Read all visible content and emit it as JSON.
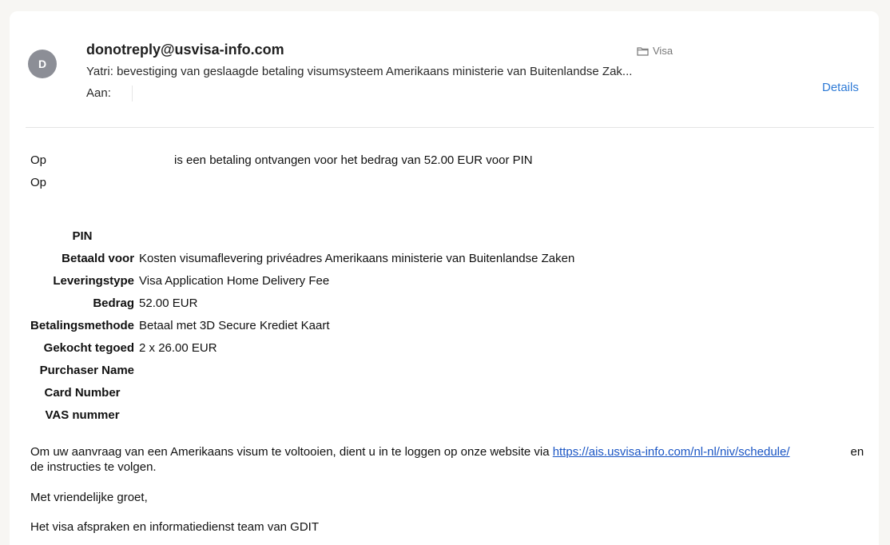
{
  "email": {
    "avatar_initial": "D",
    "sender": "donotreply@usvisa-info.com",
    "folder": "Visa",
    "subject": "Yatri: bevestiging van geslaagde betaling visumsysteem Amerikaans ministerie van Buitenlandse Zak...",
    "to_label": "Aan:",
    "details_label": "Details"
  },
  "body": {
    "intro_prefix": "Op",
    "intro_rest": "is een betaling ontvangen voor het bedrag van 52.00 EUR voor PIN",
    "intro_line2": "Op",
    "table": [
      {
        "label": "PIN",
        "value": ""
      },
      {
        "label": "Betaald voor",
        "value": "Kosten visumaflevering privéadres Amerikaans ministerie van Buitenlandse Zaken"
      },
      {
        "label": "Leveringstype",
        "value": "Visa Application Home Delivery Fee"
      },
      {
        "label": "Bedrag",
        "value": "52.00 EUR"
      },
      {
        "label": "Betalingsmethode",
        "value": "Betaal met 3D Secure Krediet Kaart"
      },
      {
        "label": "Gekocht tegoed",
        "value": "2 x 26.00 EUR"
      },
      {
        "label": "Purchaser Name",
        "value": ""
      },
      {
        "label": "Card Number",
        "value": ""
      },
      {
        "label": "VAS nummer",
        "value": ""
      }
    ],
    "instruction_before": "Om uw aanvraag van een Amerikaans visum te voltooien, dient u in te loggen op onze website via ",
    "instruction_link": "https://ais.usvisa-info.com/nl-nl/niv/schedule/",
    "instruction_after": "en de instructies te volgen.",
    "greeting": "Met vriendelijke groet,",
    "signature": "Het visa afspraken en informatiedienst team van GDIT"
  }
}
